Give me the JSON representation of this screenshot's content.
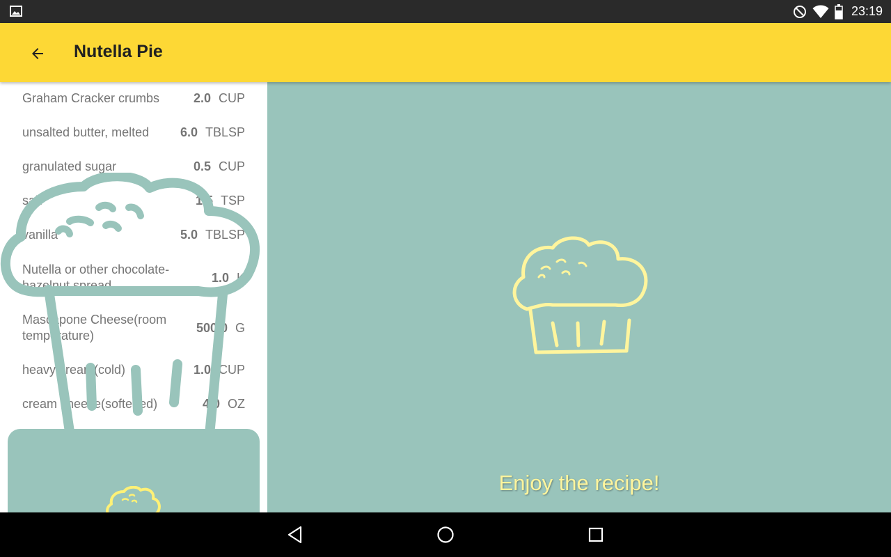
{
  "status_bar": {
    "time": "23:19",
    "left_icon": "image-notification-icon",
    "icons": [
      "do-not-disturb-icon",
      "wifi-icon",
      "battery-icon"
    ]
  },
  "toolbar": {
    "back_icon": "arrow-back-icon",
    "title": "Nutella Pie",
    "background_color": "#fdd835"
  },
  "ingredients": [
    {
      "name": "Graham Cracker crumbs",
      "quantity": "2.0",
      "unit": "CUP"
    },
    {
      "name": "unsalted butter, melted",
      "quantity": "6.0",
      "unit": "TBLSP"
    },
    {
      "name": "granulated sugar",
      "quantity": "0.5",
      "unit": "CUP"
    },
    {
      "name": "salt",
      "quantity": "1.5",
      "unit": "TSP"
    },
    {
      "name": "vanilla",
      "quantity": "5.0",
      "unit": "TBLSP"
    },
    {
      "name": "Nutella or other chocolate-hazelnut spread",
      "quantity": "1.0",
      "unit": "K"
    },
    {
      "name": "Mascapone Cheese(room temperature)",
      "quantity": "500.0",
      "unit": "G"
    },
    {
      "name": "heavy cream(cold)",
      "quantity": "1.0",
      "unit": "CUP"
    },
    {
      "name": "cream cheese(softened)",
      "quantity": "4.0",
      "unit": "OZ"
    }
  ],
  "main": {
    "message": "Enjoy the recipe!",
    "icon": "cupcake-icon",
    "background_color": "#99c4bb",
    "accent_color": "#fff59d"
  },
  "nav_bar": {
    "back": "nav-back-icon",
    "home": "nav-home-icon",
    "recents": "nav-recents-icon"
  }
}
